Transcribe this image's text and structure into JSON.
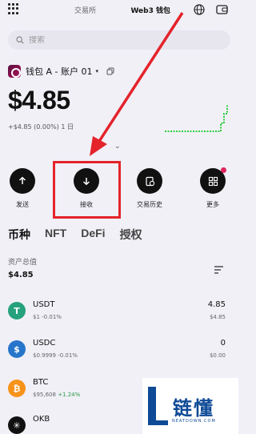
{
  "header": {
    "tabs": [
      {
        "label": "交易所",
        "active": false
      },
      {
        "label": "Web3 钱包",
        "active": true
      }
    ],
    "icons": [
      "grid-icon",
      "globe-icon",
      "wallet-icon"
    ]
  },
  "search": {
    "placeholder": "搜索",
    "icon": "search-icon"
  },
  "account": {
    "name": "钱包 A - 账户 01",
    "caret": "▾",
    "icon": "copy-icon"
  },
  "balance": {
    "value": "$4.85",
    "change": "+$4.85 (0.00%) 1 日"
  },
  "toggle_icon": "chevron-down-icon",
  "actions": [
    {
      "label": "发送",
      "icon": "arrow-up-icon"
    },
    {
      "label": "接收",
      "icon": "arrow-down-icon"
    },
    {
      "label": "交易历史",
      "icon": "history-icon"
    },
    {
      "label": "更多",
      "icon": "more-grid-icon"
    }
  ],
  "asset_tabs": [
    {
      "label": "币种",
      "active": true
    },
    {
      "label": "NFT",
      "active": false
    },
    {
      "label": "DeFi",
      "active": false
    },
    {
      "label": "授权",
      "active": false
    }
  ],
  "total": {
    "label": "资产总值",
    "value": "$4.85"
  },
  "tokens": [
    {
      "symbol": "USDT",
      "price": "$1",
      "change": "-0.01%",
      "amount": "4.85",
      "value": "$4.85",
      "color": "#26a17b",
      "glyph": "T"
    },
    {
      "symbol": "USDC",
      "price": "$0.9999",
      "change": "-0.01%",
      "amount": "0",
      "value": "$0.00",
      "color": "#2775ca",
      "glyph": "$"
    },
    {
      "symbol": "BTC",
      "price": "$95,608",
      "change": "+1.24%",
      "amount": "",
      "value": "",
      "color": "#f7931a",
      "glyph": "₿"
    },
    {
      "symbol": "OKB",
      "price": "",
      "change": "",
      "amount": "",
      "value": "",
      "color": "#111111",
      "glyph": "✳"
    }
  ],
  "watermark": {
    "title": "链懂",
    "sub": "NEATDOWN.COM"
  },
  "colors": {
    "accent": "#111111",
    "highlight": "#e4232b",
    "positive": "#2e9a47",
    "sparkline": "#2ecc40"
  }
}
